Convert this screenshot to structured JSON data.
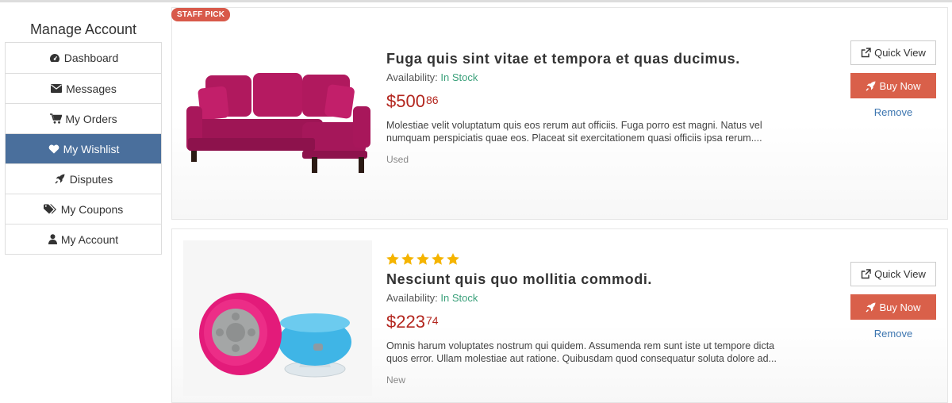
{
  "sidebar": {
    "title": "Manage Account",
    "items": [
      {
        "label": "Dashboard",
        "icon": "dashboard-icon"
      },
      {
        "label": "Messages",
        "icon": "envelope-icon"
      },
      {
        "label": "My Orders",
        "icon": "cart-icon"
      },
      {
        "label": "My Wishlist",
        "icon": "heart-icon",
        "active": true
      },
      {
        "label": "Disputes",
        "icon": "rocket-icon"
      },
      {
        "label": "My Coupons",
        "icon": "tags-icon"
      },
      {
        "label": "My Account",
        "icon": "user-icon"
      }
    ]
  },
  "products": [
    {
      "badge": "STAFF PICK",
      "title": "Fuga quis sint vitae et tempora et quas ducimus.",
      "availability_label": "Availability:",
      "availability": "In Stock",
      "price_main": "$500",
      "price_cents": "86",
      "description": "Molestiae velit voluptatum quis eos rerum aut officiis. Fuga porro est magni. Natus vel numquam perspiciatis quae eos. Placeat sit exercitationem quasi officiis ipsa rerum....",
      "condition": "Used",
      "image": "pink-sofa-image"
    },
    {
      "rating": 5,
      "title": "Nesciunt quis quo mollitia commodi.",
      "availability_label": "Availability:",
      "availability": "In Stock",
      "price_main": "$223",
      "price_cents": "74",
      "description": "Omnis harum voluptates nostrum qui quidem. Assumenda rem sunt iste ut tempore dicta quos error. Ullam molestiae aut ratione. Quibusdam quod consequatur soluta dolore ad...",
      "condition": "New",
      "image": "shower-speakers-image"
    }
  ],
  "actions": {
    "quick_view": "Quick View",
    "buy_now": "Buy Now",
    "remove": "Remove"
  },
  "colors": {
    "active_menu": "#4a6f9c",
    "buy_button": "#d9604a",
    "badge": "#d8594a",
    "price": "#b3261e",
    "in_stock": "#3aa07a",
    "link": "#3d76b0",
    "star": "#f5b400"
  }
}
